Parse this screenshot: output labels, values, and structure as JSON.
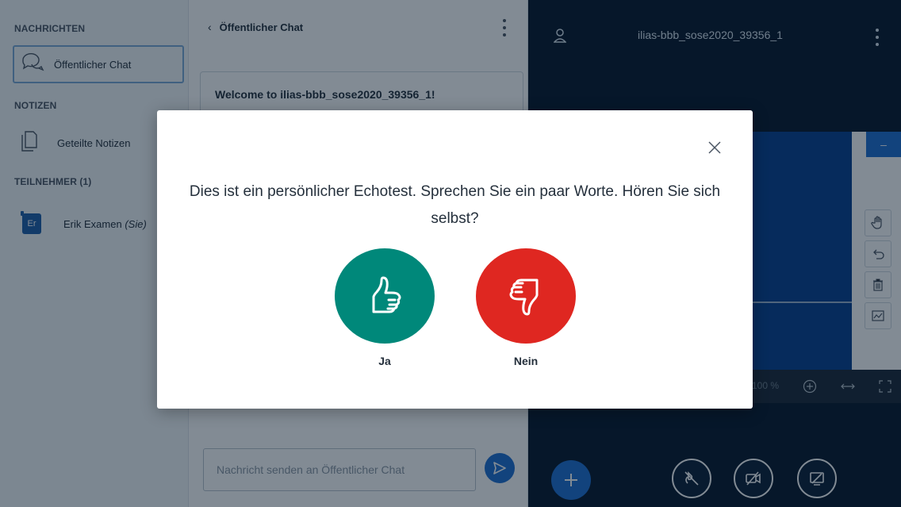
{
  "sidebar": {
    "messages_heading": "NACHRICHTEN",
    "public_chat_label": "Öffentlicher Chat",
    "notes_heading": "NOTIZEN",
    "shared_notes_label": "Geteilte Notizen",
    "participants_heading": "TEILNEHMER (1)",
    "user": {
      "initials": "Er",
      "name": "Erik Examen",
      "you_label": "(Sie)"
    }
  },
  "chat": {
    "back_label": "Öffentlicher Chat",
    "welcome_message": "Welcome to ilias-bbb_sose2020_39356_1!",
    "input_placeholder": "Nachricht senden an Öffentlicher Chat"
  },
  "presentation": {
    "meeting_title": "ilias-bbb_sose2020_39356_1",
    "zoom_level": "100 %"
  },
  "modal": {
    "message": "Dies ist ein persönlicher Echotest. Sprechen Sie ein paar Worte. Hören Sie sich selbst?",
    "yes_label": "Ja",
    "no_label": "Nein"
  },
  "colors": {
    "accent": "#1e6ed1",
    "yes": "#00887a",
    "no": "#df2721",
    "presentation_bg": "#06172a"
  },
  "icons": [
    "speech-bubbles-icon",
    "notes-icon",
    "user-icon",
    "kebab-menu-icon",
    "send-icon",
    "close-icon",
    "thumbs-up-icon",
    "thumbs-down-icon",
    "hand-tool-icon",
    "undo-icon",
    "trash-icon",
    "chart-icon",
    "zoom-in-icon",
    "fit-width-icon",
    "fullscreen-icon",
    "plus-icon",
    "mic-off-icon",
    "camera-off-icon",
    "screenshare-off-icon"
  ]
}
